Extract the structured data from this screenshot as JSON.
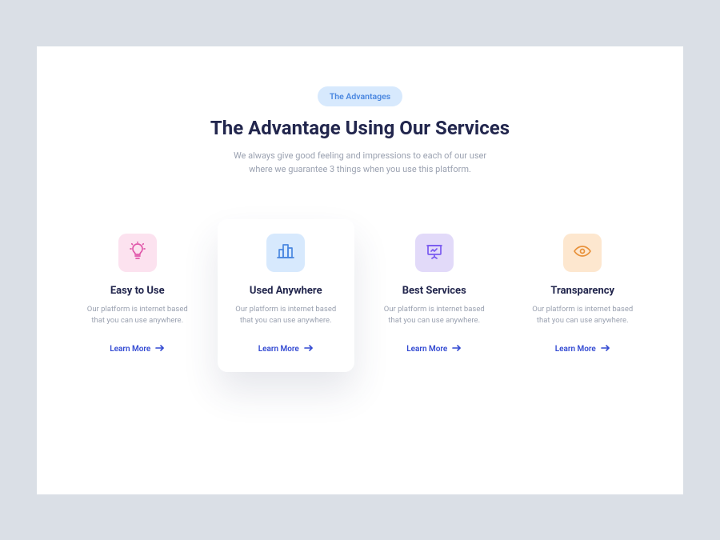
{
  "header": {
    "pill": "The Advantages",
    "title": "The Advantage Using Our Services",
    "subtitle_line1": "We always give good feeling and impressions to each of our user",
    "subtitle_line2": "where we guarantee 3 things when you use this platform."
  },
  "cards": {
    "learn_more_label": "Learn More",
    "items": [
      {
        "title": "Easy to Use",
        "desc_line1": "Our platform is internet based",
        "desc_line2": "that you can use anywhere.",
        "tile_class": "tile-pink",
        "icon": "lightbulb-icon",
        "icon_color": "#e056a9",
        "elevated": false
      },
      {
        "title": "Used Anywhere",
        "desc_line1": "Our platform is internet based",
        "desc_line2": "that you can use anywhere.",
        "tile_class": "tile-blue",
        "icon": "buildings-icon",
        "icon_color": "#4a87e0",
        "elevated": true
      },
      {
        "title": "Best Services",
        "desc_line1": "Our platform is internet based",
        "desc_line2": "that you can use anywhere.",
        "tile_class": "tile-purple",
        "icon": "presentation-icon",
        "icon_color": "#7a5af0",
        "elevated": false
      },
      {
        "title": "Transparency",
        "desc_line1": "Our platform is internet based",
        "desc_line2": "that you can use anywhere.",
        "tile_class": "tile-orange",
        "icon": "eye-icon",
        "icon_color": "#e8913a",
        "elevated": false
      }
    ]
  }
}
